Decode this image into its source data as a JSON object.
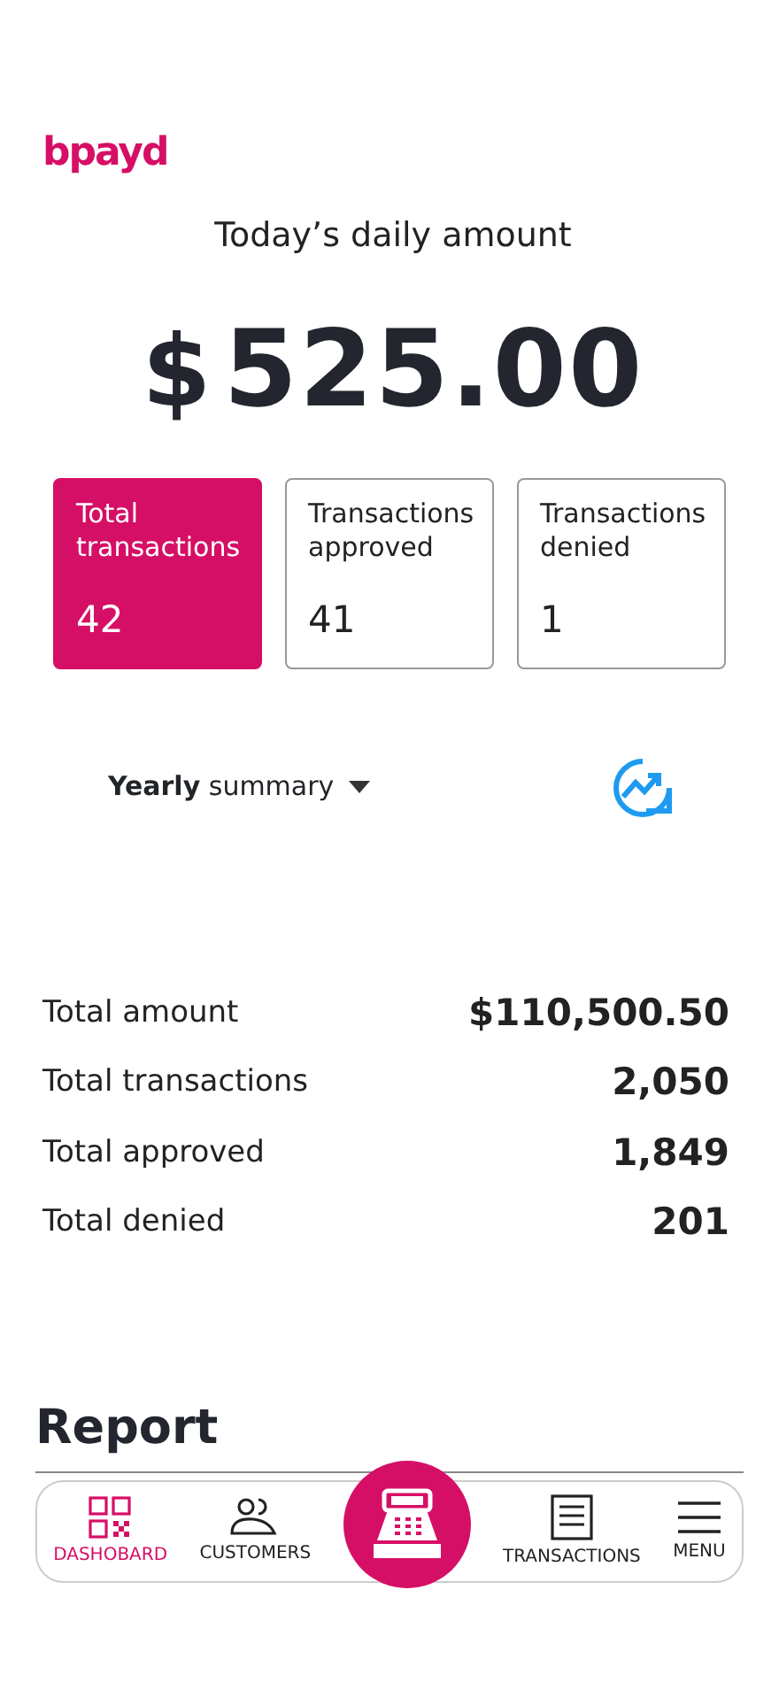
{
  "logo": "bpayd",
  "title": "Today’s daily amount",
  "amount": {
    "currency": "$",
    "value": "525.00"
  },
  "stats": [
    {
      "label": "Total transactions",
      "value": "42",
      "selected": true
    },
    {
      "label": "Transactions approved",
      "value": "41",
      "selected": false
    },
    {
      "label": "Transactions denied",
      "value": "1",
      "selected": false
    }
  ],
  "summary": {
    "period": "Yearly",
    "label": "summary"
  },
  "totals": [
    {
      "label": "Total amount",
      "value": "$110,500.50"
    },
    {
      "label": "Total transactions",
      "value": "2,050"
    },
    {
      "label": "Total approved",
      "value": "1,849"
    },
    {
      "label": "Total denied",
      "value": "201"
    }
  ],
  "report": {
    "title": "Report"
  },
  "nav": [
    {
      "kind": "tab",
      "label": "DASHOBARD",
      "selected": true
    },
    {
      "kind": "tab",
      "label": "CUSTOMERS",
      "selected": false
    },
    {
      "kind": "action"
    },
    {
      "kind": "tab",
      "label": "TRANSACTIONS",
      "selected": false
    },
    {
      "kind": "tab",
      "label": "MENU",
      "selected": false
    }
  ]
}
